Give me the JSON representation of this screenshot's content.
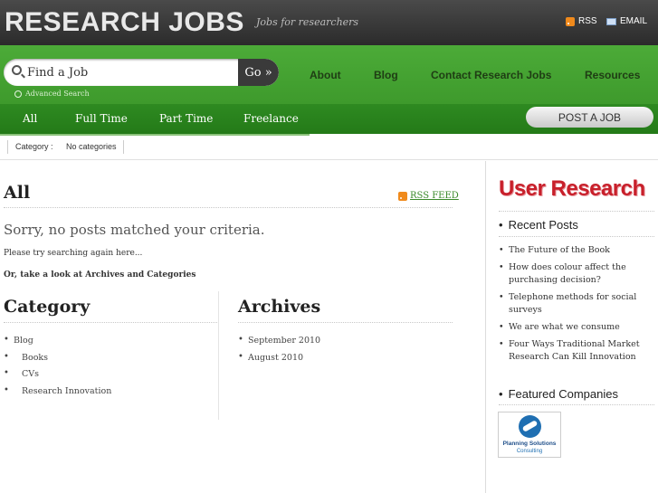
{
  "header": {
    "site_title": "RESEARCH JOBS",
    "tagline": "Jobs for researchers",
    "rss_label": "RSS",
    "email_label": "EMAIL"
  },
  "search": {
    "placeholder": "Find a Job",
    "go_label": "Go »",
    "advanced_label": "Advanced Search"
  },
  "main_nav": [
    "About",
    "Blog",
    "Contact Research Jobs",
    "Resources"
  ],
  "sub_nav": [
    "All",
    "Full Time",
    "Part Time",
    "Freelance"
  ],
  "post_job_label": "POST A JOB",
  "category_filter": {
    "label": "Category :",
    "value": "No categories"
  },
  "main": {
    "title": "All",
    "rss_feed_label": "RSS FEED",
    "sorry": "Sorry, no posts matched your criteria.",
    "try_again": "Please try searching again here...",
    "or_look": "Or, take a look at Archives and Categories"
  },
  "category_section": {
    "heading": "Category",
    "items": [
      {
        "label": "Blog",
        "sub": false
      },
      {
        "label": "Books",
        "sub": true
      },
      {
        "label": "CVs",
        "sub": true
      },
      {
        "label": "Research Innovation",
        "sub": true
      }
    ]
  },
  "archives_section": {
    "heading": "Archives",
    "items": [
      "September 2010",
      "August 2010"
    ]
  },
  "sidebar": {
    "logo_text": "User Research",
    "recent_posts_heading": "Recent Posts",
    "recent_posts": [
      "The Future of the Book",
      "How does colour affect the purchasing decision?",
      "Telephone methods for social surveys",
      "We are what we consume",
      "Four Ways Traditional Market Research Can Kill Innovation"
    ],
    "featured_heading": "Featured Companies",
    "company_name": "Planning Solutions",
    "company_sub": "Consulting"
  },
  "colors": {
    "green": "#45a432",
    "dark_green": "#2a821c",
    "header_dark": "#333333",
    "link_green": "#3a8a2a",
    "logo_red": "#c8202b"
  }
}
